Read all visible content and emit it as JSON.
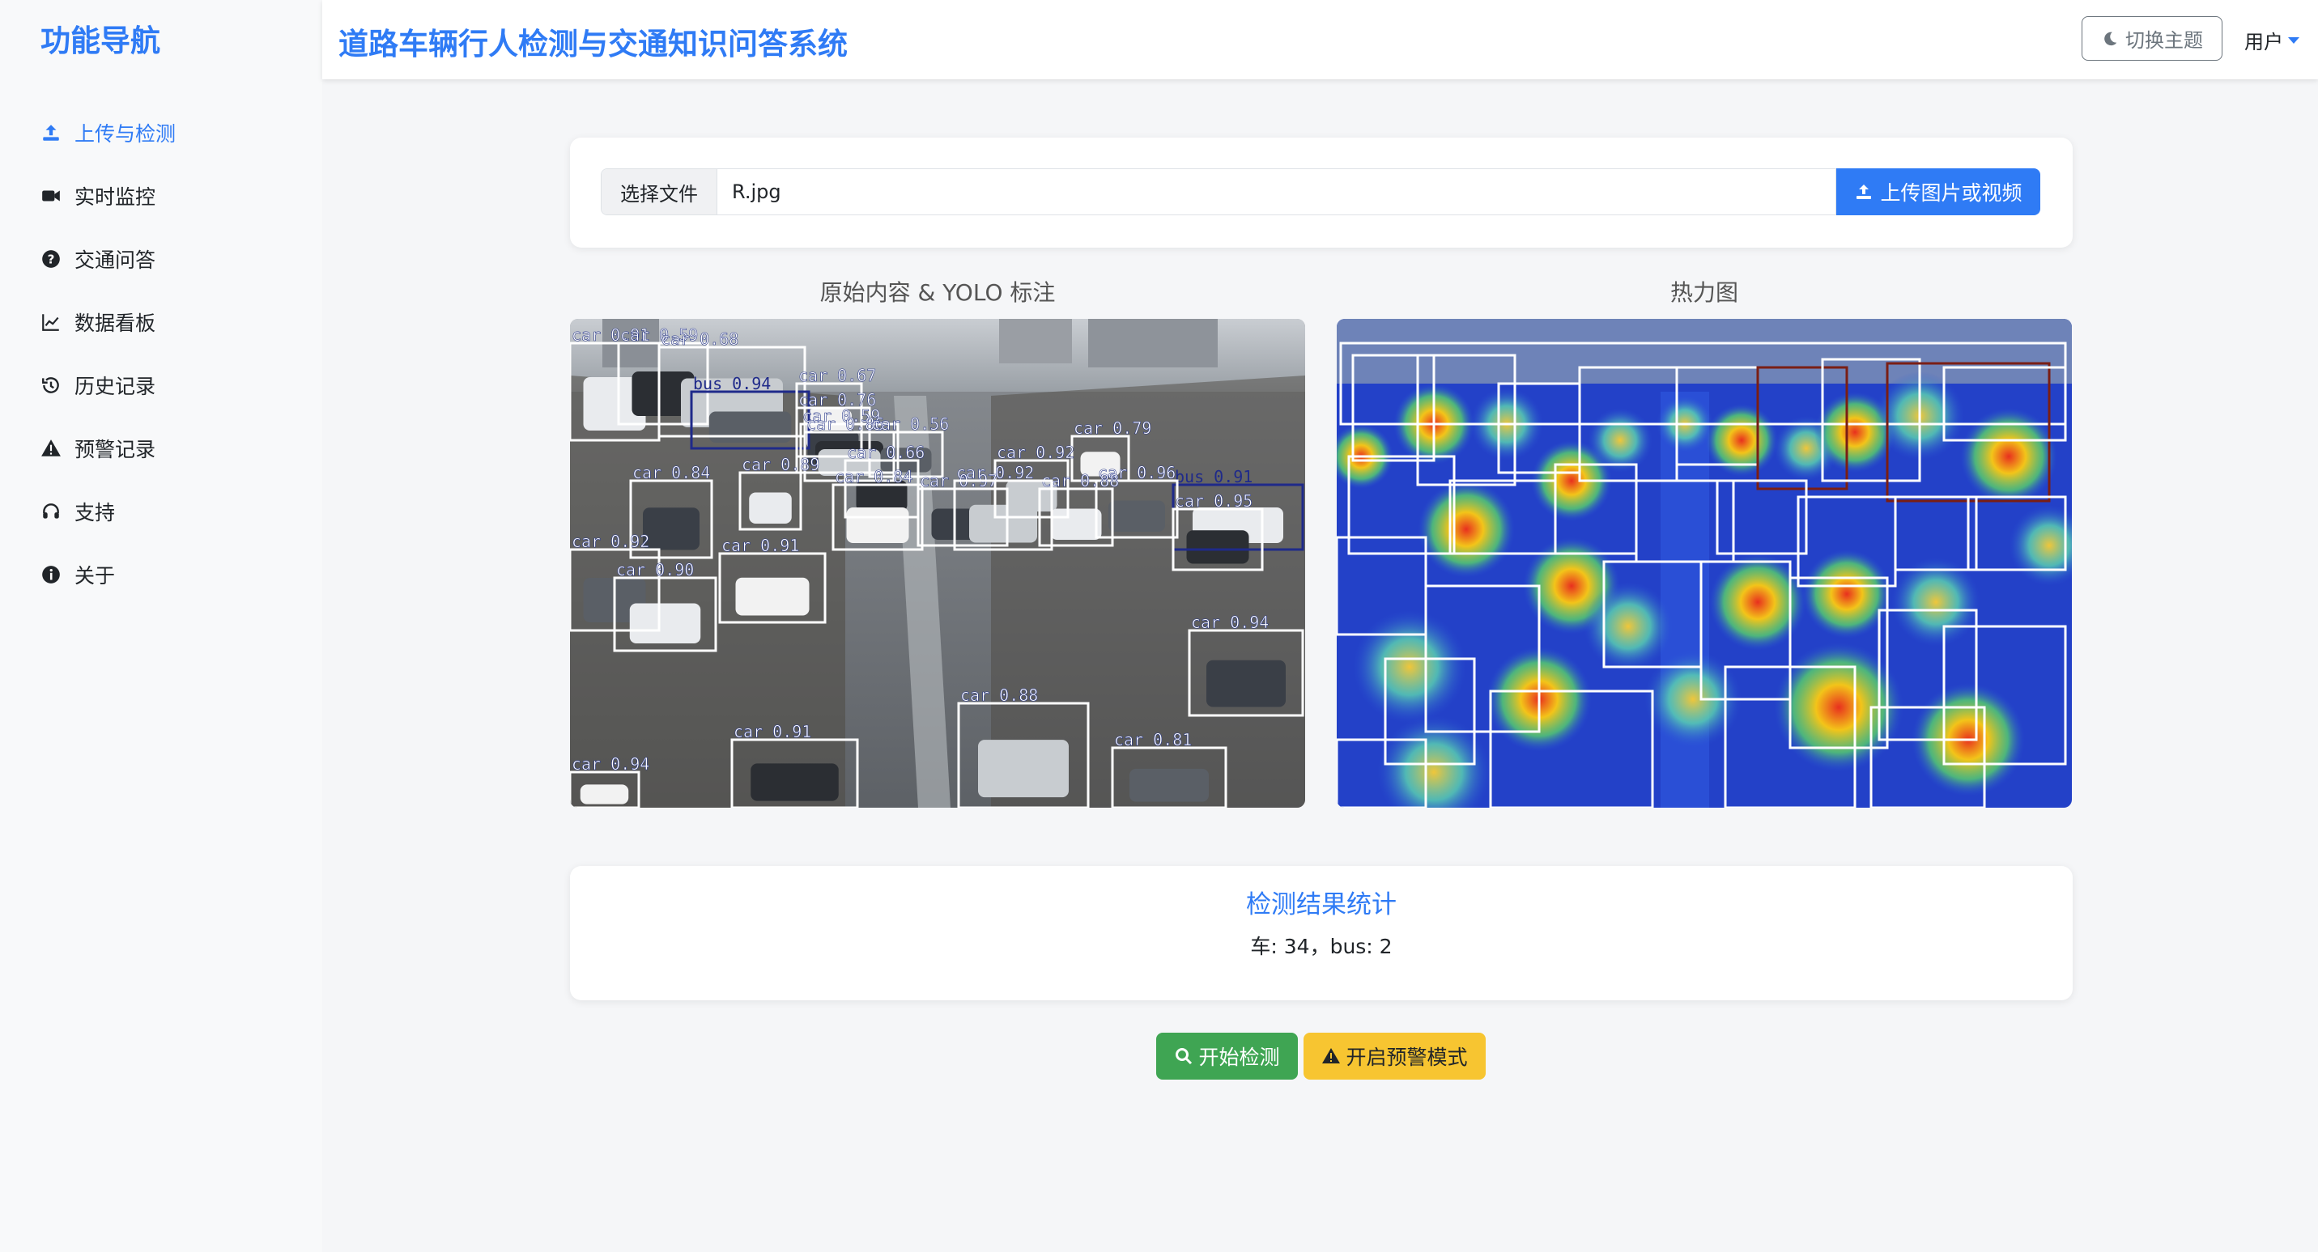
{
  "sidebar": {
    "brand": "功能导航",
    "items": [
      {
        "label": "上传与检测",
        "icon": "upload-icon",
        "active": true
      },
      {
        "label": "实时监控",
        "icon": "video-camera-icon"
      },
      {
        "label": "交通问答",
        "icon": "question-circle-icon"
      },
      {
        "label": "数据看板",
        "icon": "line-chart-icon"
      },
      {
        "label": "历史记录",
        "icon": "history-icon"
      },
      {
        "label": "预警记录",
        "icon": "warning-triangle-icon"
      },
      {
        "label": "支持",
        "icon": "headset-icon"
      },
      {
        "label": "关于",
        "icon": "info-circle-icon"
      }
    ]
  },
  "header": {
    "title": "道路车辆行人检测与交通知识问答系统",
    "theme_button": "切换主题",
    "user_menu": "用户"
  },
  "upload": {
    "choose_file_label": "选择文件",
    "file_name": "R.jpg",
    "upload_button": "上传图片或视频"
  },
  "panels": {
    "original_label": "原始内容 & YOLO 标注",
    "heatmap_label": "热力图",
    "detections": [
      {
        "label": "car 0.91"
      },
      {
        "label": "car 0.59"
      },
      {
        "label": "car 0.68"
      },
      {
        "label": "bus 0.94"
      },
      {
        "label": "car 0.67"
      },
      {
        "label": "car 0.76"
      },
      {
        "label": "bus 0.91"
      },
      {
        "label": "car 0.59"
      },
      {
        "label": "car 0.86"
      },
      {
        "label": "car 0.56"
      },
      {
        "label": "car 0.79"
      },
      {
        "label": "car 0.84"
      },
      {
        "label": "car 0.89"
      },
      {
        "label": "car 0.66"
      },
      {
        "label": "car 0.92"
      },
      {
        "label": "car 0.96"
      },
      {
        "label": "car 0.84"
      },
      {
        "label": "car 0.97"
      },
      {
        "label": "car 0.88"
      },
      {
        "label": "car 0.95"
      },
      {
        "label": "car 0.92"
      },
      {
        "label": "car 0.92"
      },
      {
        "label": "car 0.91"
      },
      {
        "label": "car 0.94"
      },
      {
        "label": "car 0.90"
      },
      {
        "label": "car 0.91"
      },
      {
        "label": "car 0.88"
      },
      {
        "label": "car 0.81"
      },
      {
        "label": "car 0.94"
      }
    ]
  },
  "stats": {
    "title": "检测结果统计",
    "summary": "车: 34，bus: 2"
  },
  "actions": {
    "start_button": "开始检测",
    "warning_button": "开启预警模式"
  },
  "colors": {
    "accent": "#2f7bf5",
    "success": "#3fa553",
    "warning": "#f7c531"
  }
}
